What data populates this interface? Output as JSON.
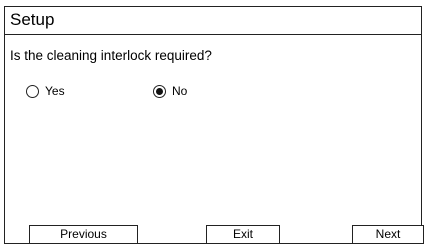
{
  "window": {
    "title": "Setup"
  },
  "prompt": {
    "question": "Is the cleaning interlock required?"
  },
  "options": {
    "yes_label": "Yes",
    "no_label": "No",
    "selected": "No"
  },
  "buttons": {
    "previous_label": "Previous",
    "exit_label": "Exit",
    "next_label": "Next"
  }
}
